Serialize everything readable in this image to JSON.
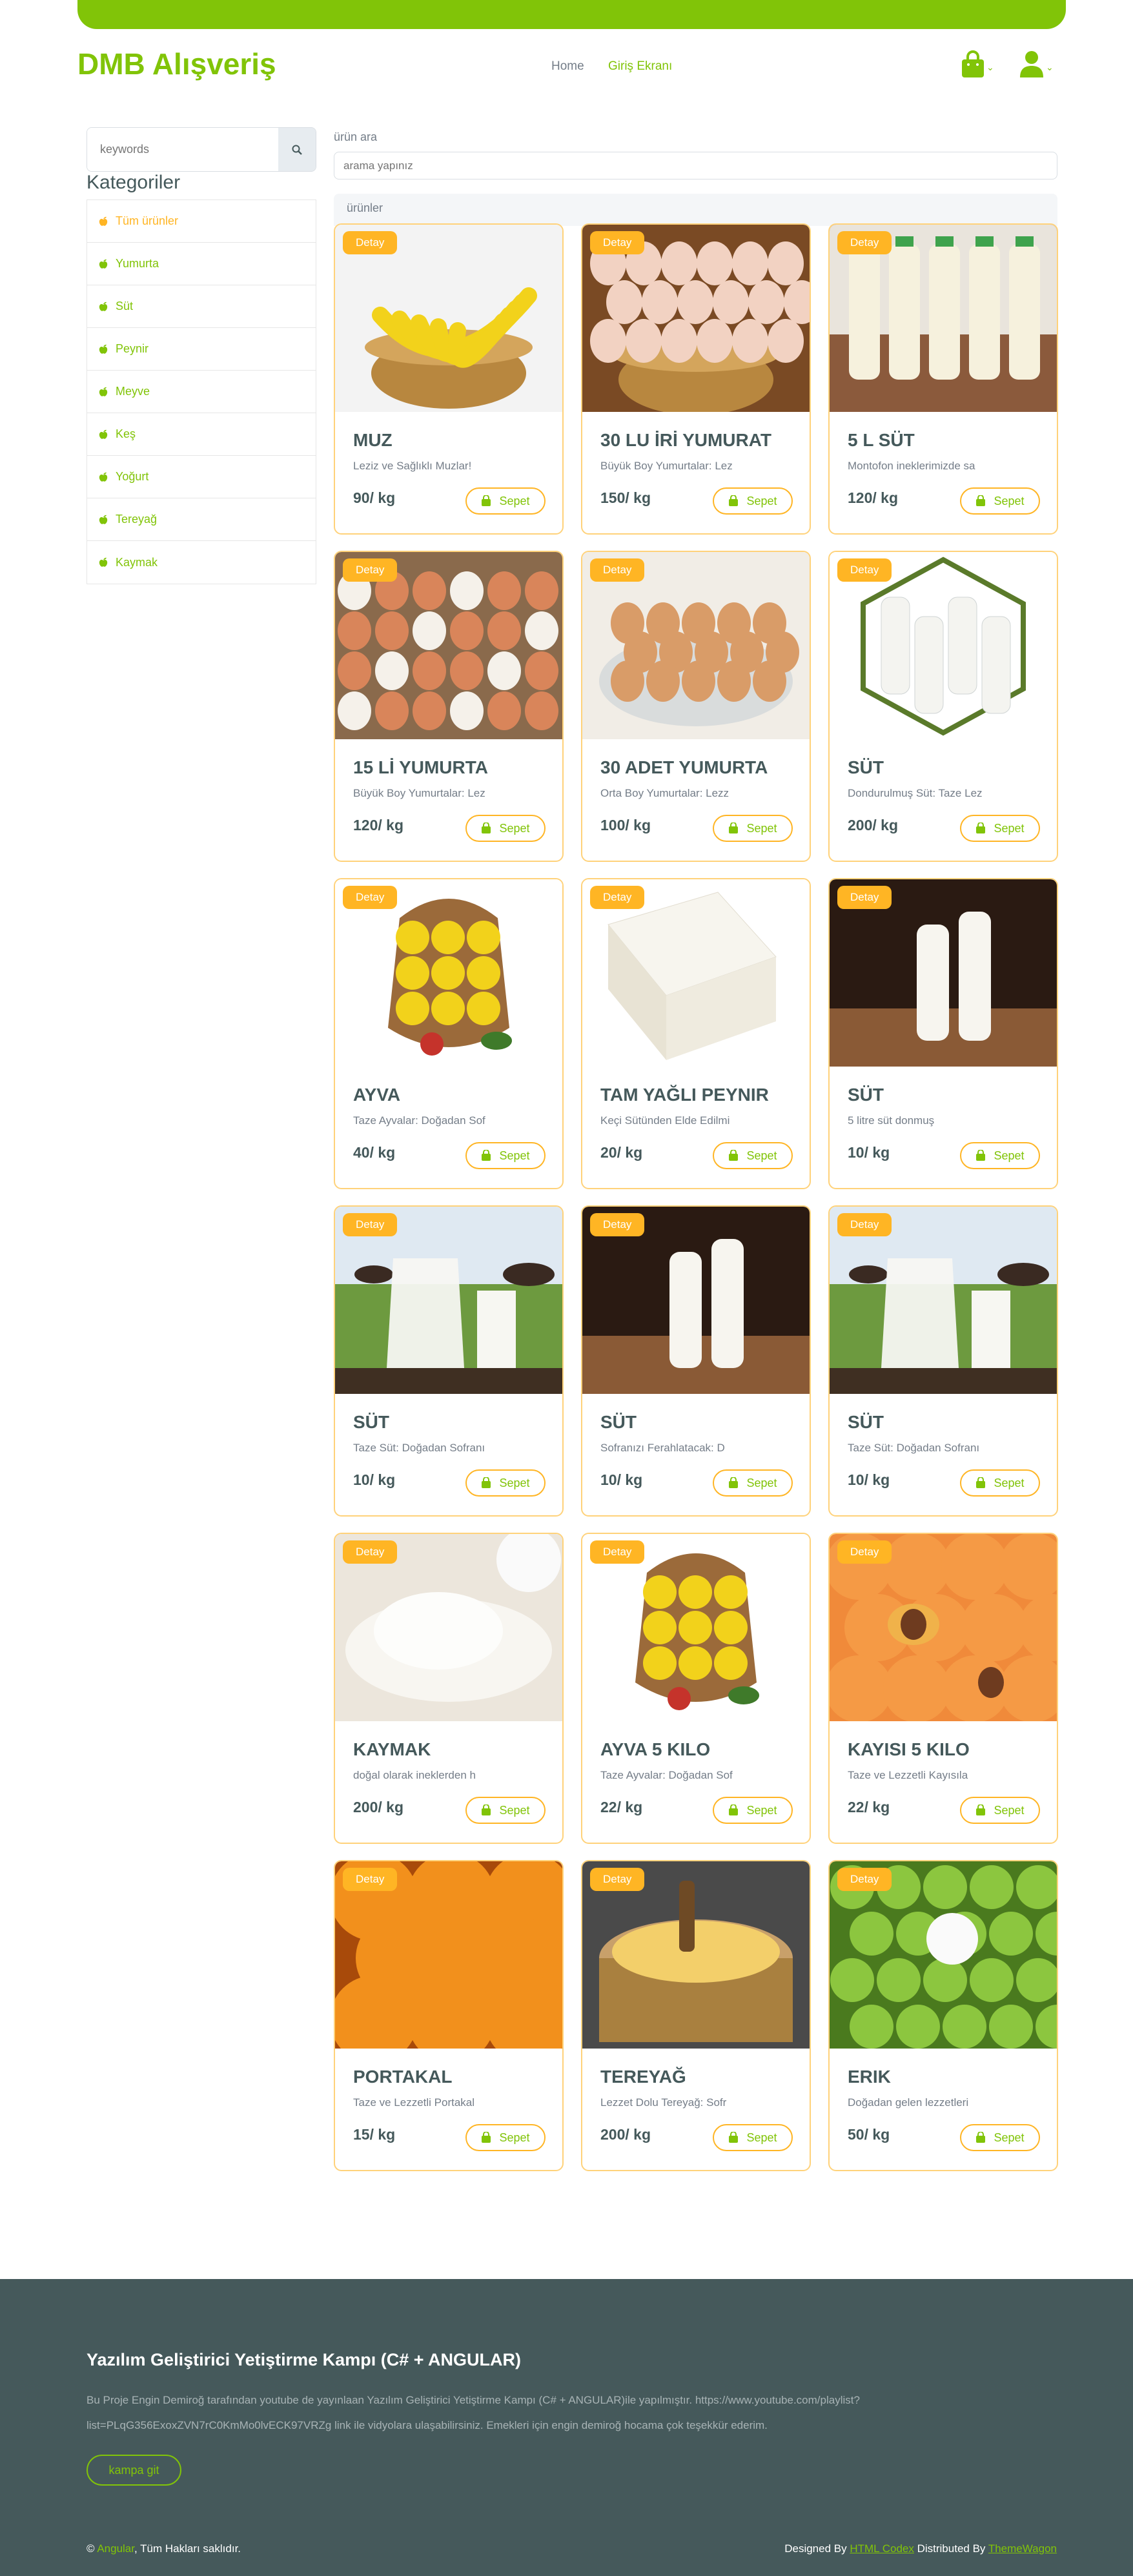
{
  "header": {
    "brand": "DMB Alışveriş",
    "nav": [
      "Home",
      "Giriş Ekranı"
    ],
    "icons": [
      "shopping-bag-icon",
      "user-icon"
    ],
    "accent_color": "#81c408",
    "secondary_color": "#ffb524"
  },
  "sidebar": {
    "search_placeholder": "keywords",
    "title": "Kategoriler",
    "categories": [
      {
        "label": "Tüm ürünler",
        "active": true
      },
      {
        "label": "Yumurta"
      },
      {
        "label": "Süt"
      },
      {
        "label": "Peynir"
      },
      {
        "label": "Meyve"
      },
      {
        "label": "Keş"
      },
      {
        "label": "Yoğurt"
      },
      {
        "label": "Tereyağ"
      },
      {
        "label": "Kaymak"
      }
    ]
  },
  "main": {
    "search_label": "ürün ara",
    "search_placeholder": "arama yapınız",
    "section_title": "ürünler",
    "badge_label": "Detay",
    "cart_label": "Sepet",
    "products": [
      {
        "name": "MUZ",
        "desc": "Leziz ve Sağlıklı Muzlar!",
        "price": "90/ kg",
        "image": "bananas"
      },
      {
        "name": "30 LU İRİ YUMURAT",
        "desc": "Büyük Boy Yumurtalar: Lez",
        "price": "150/ kg",
        "image": "eggs-basket"
      },
      {
        "name": "5 L SÜT",
        "desc": "Montofon ineklerimizde sa",
        "price": "120/ kg",
        "image": "milk-bottles"
      },
      {
        "name": "15 Lİ YUMURTA",
        "desc": "Büyük Boy Yumurtalar: Lez",
        "price": "120/ kg",
        "image": "eggs-crate"
      },
      {
        "name": "30 ADET YUMURTA",
        "desc": "Orta Boy Yumurtalar: Lezz",
        "price": "100/ kg",
        "image": "eggs-glass-bowl"
      },
      {
        "name": "SÜT",
        "desc": "Dondurulmuş Süt: Taze Lez",
        "price": "200/ kg",
        "image": "milk-hexagon"
      },
      {
        "name": "AYVA",
        "desc": "Taze Ayvalar: Doğadan Sof",
        "price": "40/ kg",
        "image": "quince-basket"
      },
      {
        "name": "TAM YAĞLI PEYNIR",
        "desc": "Keçi Sütünden Elde Edilmi",
        "price": "20/ kg",
        "image": "white-cheese"
      },
      {
        "name": "SÜT",
        "desc": "5 litre süt donmuş",
        "price": "10/ kg",
        "image": "milk-dark"
      },
      {
        "name": "SÜT",
        "desc": "Taze Süt: Doğadan Sofranı",
        "price": "10/ kg",
        "image": "milk-farm"
      },
      {
        "name": "SÜT",
        "desc": "Sofranızı Ferahlatacak: D",
        "price": "10/ kg",
        "image": "milk-dark"
      },
      {
        "name": "SÜT",
        "desc": "Taze Süt: Doğadan Sofranı",
        "price": "10/ kg",
        "image": "milk-farm"
      },
      {
        "name": "KAYMAK",
        "desc": "doğal olarak ineklerden h",
        "price": "200/ kg",
        "image": "cream"
      },
      {
        "name": "AYVA 5 KILO",
        "desc": "Taze Ayvalar: Doğadan Sof",
        "price": "22/ kg",
        "image": "quince-basket"
      },
      {
        "name": "KAYISI 5 KILO",
        "desc": "Taze ve Lezzetli Kayısıla",
        "price": "22/ kg",
        "image": "apricots"
      },
      {
        "name": "PORTAKAL",
        "desc": "Taze ve Lezzetli Portakal",
        "price": "15/ kg",
        "image": "oranges"
      },
      {
        "name": "TEREYAĞ",
        "desc": "Lezzet Dolu Tereyağ: Sofr",
        "price": "200/ kg",
        "image": "butter"
      },
      {
        "name": "ERIK",
        "desc": "Doğadan gelen lezzetleri",
        "price": "50/ kg",
        "image": "green-plums"
      }
    ]
  },
  "footer": {
    "title": "Yazılım Geliştirici Yetiştirme Kampı (C# + ANGULAR)",
    "text": "Bu Proje Engin Demiroğ tarafından youtube de yayınlaan Yazılım Geliştirici Yetiştirme Kampı (C# + ANGULAR)ile yapılmıştır. https://www.youtube.com/playlist?list=PLqG356ExoxZVN7rC0KmMo0lvECK97VRZg link ile vidyolara ulaşabilirsiniz. Emekleri için engin demiroğ hocama çok teşekkür ederim.",
    "button": "kampa git",
    "copyright_link": "Angular",
    "copyright_text": ", Tüm Hakları saklıdır.",
    "designed_by": "Designed By",
    "designer": "HTML Codex",
    "distributed_by": "Distributed By",
    "distributor": "ThemeWagon"
  }
}
